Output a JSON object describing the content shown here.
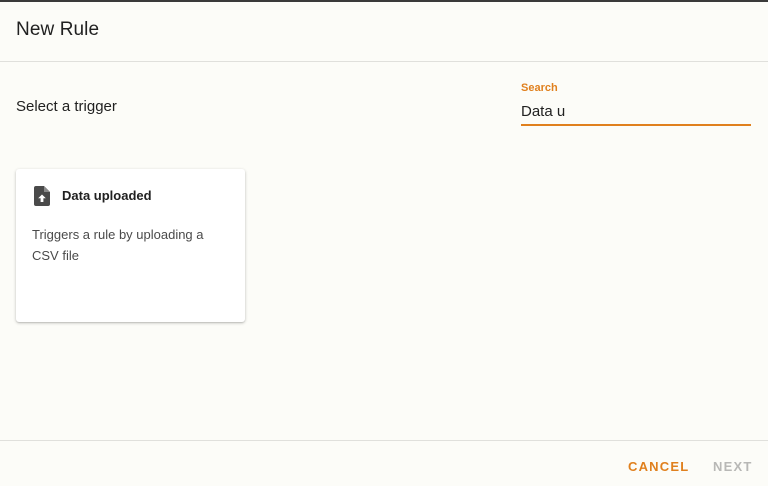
{
  "dialog": {
    "title": "New Rule"
  },
  "trigger_section": {
    "label": "Select a trigger"
  },
  "search": {
    "label": "Search",
    "value": "Data u"
  },
  "results": [
    {
      "icon": "file-upload-icon",
      "title": "Data uploaded",
      "description": "Triggers a rule by uploading a CSV file"
    }
  ],
  "footer": {
    "cancel_label": "CANCEL",
    "next_label": "NEXT",
    "next_enabled": false
  },
  "colors": {
    "accent": "#e0801e",
    "disabled": "#b8b8b6",
    "background": "#fcfcf8"
  }
}
